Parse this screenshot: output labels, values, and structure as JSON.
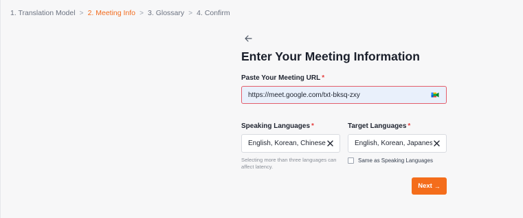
{
  "breadcrumb": {
    "steps": [
      {
        "label": "1. Translation Model"
      },
      {
        "label": "2. Meeting Info"
      },
      {
        "label": "3. Glossary"
      },
      {
        "label": "4. Confirm"
      }
    ],
    "separator": ">",
    "active_index": 1,
    "active_color": "#f26b1d"
  },
  "form": {
    "title": "Enter Your Meeting Information",
    "url": {
      "label": "Paste Your Meeting URL",
      "required_mark": "*",
      "value": "https://meet.google.com/txt-bksq-zxy",
      "icon": "google-meet-icon"
    },
    "speaking": {
      "label": "Speaking Languages",
      "required_mark": "*",
      "value": "English, Korean, Chinese",
      "hint": "Selecting more than three languages can affect latency."
    },
    "target": {
      "label": "Target Languages",
      "required_mark": "*",
      "value": "English, Korean, Japanese",
      "same_as_label": "Same as Speaking Languages",
      "same_as_checked": false
    },
    "next_label": "Next",
    "next_arrow": "→"
  },
  "colors": {
    "accent": "#f46d1b",
    "error_border": "#e35d6a",
    "input_fill": "#e9f0fb"
  }
}
